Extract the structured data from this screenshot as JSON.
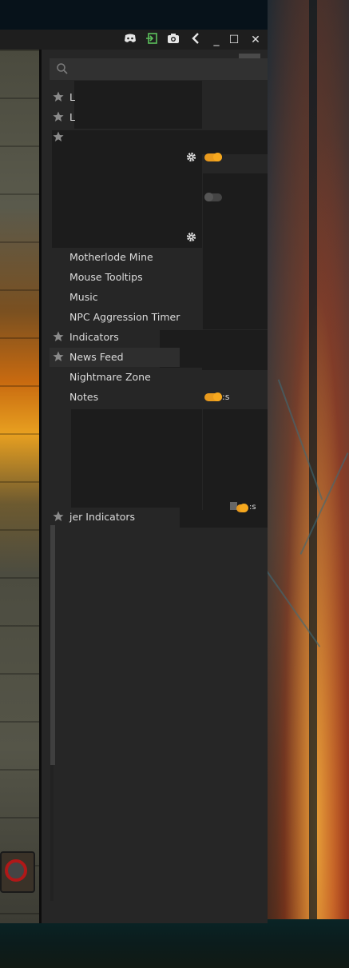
{
  "window": {
    "title_icons": [
      "discord-icon",
      "login-icon",
      "camera-icon",
      "back-icon",
      "minimize-icon",
      "maximize-icon",
      "close-icon"
    ],
    "minimize_glyph": "_",
    "maximize_glyph": "☐",
    "close_glyph": "✕"
  },
  "search": {
    "placeholder": "",
    "value": ""
  },
  "plugins": [
    {
      "label": "L",
      "starred": true
    },
    {
      "label": "L",
      "starred": true
    },
    {
      "label": "",
      "starred": true
    },
    {
      "label": "Motherlode Mine",
      "starred": false
    },
    {
      "label": "Mouse Tooltips",
      "starred": false
    },
    {
      "label": "Music",
      "starred": false
    },
    {
      "label": "NPC Aggression Timer",
      "starred": false
    },
    {
      "label": "Indicators",
      "starred": true
    },
    {
      "label": "News Feed",
      "starred": true
    },
    {
      "label": "Nightmare Zone",
      "starred": false
    },
    {
      "label": "Notes",
      "starred": false
    },
    {
      "label": "jer Indicators",
      "starred": true
    }
  ],
  "fragments": {
    "notes_suffix": ":s",
    "lower_suffix": ":s"
  },
  "colors": {
    "accent": "#e89a1e",
    "toggle_off": "#4a4a4a",
    "star": "#8a8a8a",
    "text": "#dcdcdc"
  }
}
